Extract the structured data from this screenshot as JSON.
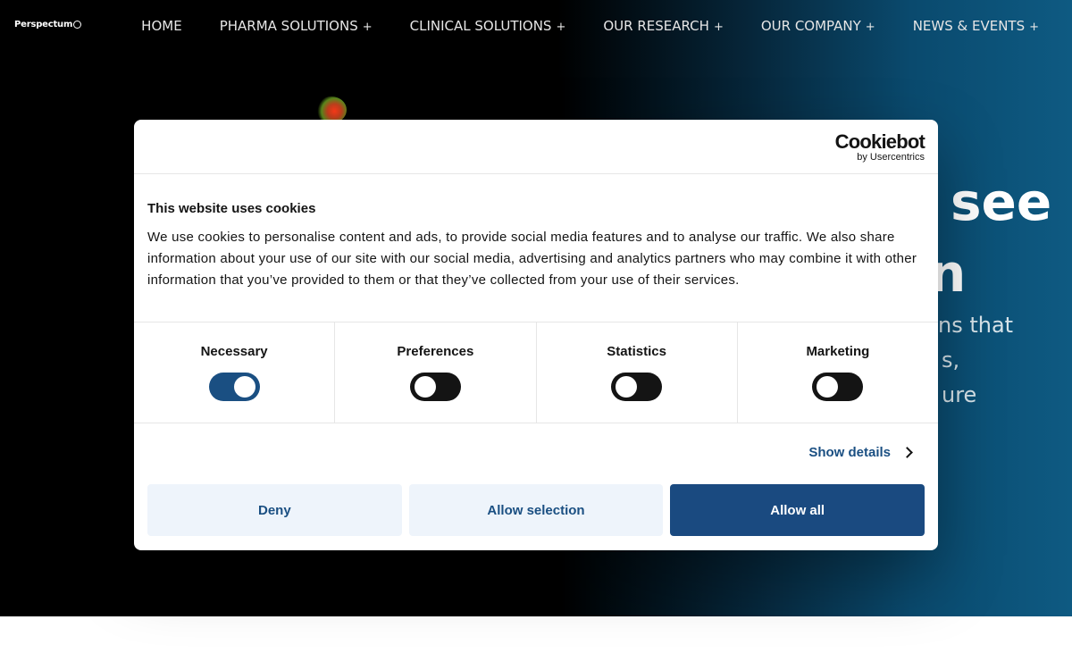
{
  "site": {
    "logo_text": "Perspectum",
    "nav": [
      {
        "label": "HOME",
        "has_submenu": false
      },
      {
        "label": "PHARMA SOLUTIONS",
        "has_submenu": true
      },
      {
        "label": "CLINICAL SOLUTIONS",
        "has_submenu": true
      },
      {
        "label": "OUR RESEARCH",
        "has_submenu": true
      },
      {
        "label": "OUR COMPANY",
        "has_submenu": true
      },
      {
        "label": "NEWS & EVENTS",
        "has_submenu": true
      }
    ],
    "submenu_symbol": "+",
    "hero": {
      "heading_line1": "see",
      "heading_line2": "n",
      "paragraph_line1": "ns that",
      "paragraph_line2": "s,",
      "paragraph_line3": "ure"
    }
  },
  "cookie_dialog": {
    "brand": "Cookiebot",
    "brand_sub": "by Usercentrics",
    "title": "This website uses cookies",
    "text": "We use cookies to personalise content and ads, to provide social media features and to analyse our traffic. We also share information about your use of our site with our social media, advertising and analytics partners who may combine it with other information that you’ve provided to them or that they’ve collected from your use of their services.",
    "categories": [
      {
        "label": "Necessary",
        "enabled": true
      },
      {
        "label": "Preferences",
        "enabled": false
      },
      {
        "label": "Statistics",
        "enabled": false
      },
      {
        "label": "Marketing",
        "enabled": false
      }
    ],
    "show_details": "Show details",
    "buttons": {
      "deny": "Deny",
      "allow_selection": "Allow selection",
      "allow_all": "Allow all"
    }
  },
  "colors": {
    "accent": "#1a4f82",
    "button_light": "#eef4fb",
    "button_primary": "#1a4a80"
  }
}
